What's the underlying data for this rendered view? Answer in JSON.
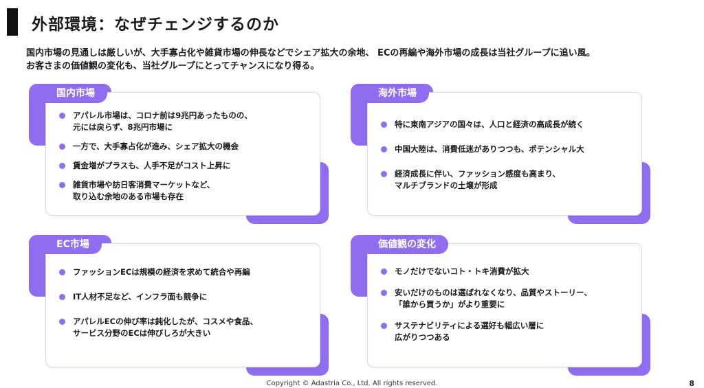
{
  "page": {
    "title": "外部環境：なぜチェンジするのか",
    "intro_lines": [
      "国内市場の見通しは厳しいが、大手寡占化や雑貨市場の伸長などでシェア拡大の余地、 ECの再編や海外市場の成長は当社グループに追い風。",
      "お客さまの価値観の変化も、当社グループにとってチャンスになり得る。"
    ],
    "accent_color": "#8f6df0"
  },
  "panels": {
    "domestic": {
      "tag": "国内市場",
      "items": [
        [
          "アパレル市場は、コロナ前は9兆円あったものの、",
          "元には戻らず、8兆円市場に"
        ],
        [
          "一方で、大手寡占化が進み、シェア拡大の機会"
        ],
        [
          "賃金増がプラスも、人手不足がコスト上昇に"
        ],
        [
          "雑貨市場や訪日客消費マーケットなど、",
          "取り込む余地のある市場も存在"
        ]
      ]
    },
    "overseas": {
      "tag": "海外市場",
      "items": [
        [
          "特に東南アジアの国々は、人口と経済の高成長が続く"
        ],
        [
          "中国大陸は、消費低迷がありつつも、ポテンシャル大"
        ],
        [
          "経済成長に伴い、ファッション感度も高まり、",
          "マルチブランドの土壌が形成"
        ]
      ]
    },
    "ec": {
      "tag": "EC市場",
      "items": [
        [
          "ファッションECは規模の経済を求めて統合や再編"
        ],
        [
          "IT人材不足など、インフラ面も競争に"
        ],
        [
          "アパレルECの伸び率は鈍化したが、コスメや食品、",
          "サービス分野のECは伸びしろが大きい"
        ]
      ]
    },
    "values": {
      "tag": "価値観の変化",
      "items": [
        [
          "モノだけでないコト・トキ消費が拡大"
        ],
        [
          "安いだけのものは選ばれなくなり、品質やストーリー、",
          "「誰から買うか」がより重要に"
        ],
        [
          "サステナビリティによる選好も幅広い層に",
          "広がりつつある"
        ]
      ]
    }
  },
  "footer": {
    "copyright": "Copyright © Adastria Co., Ltd. All rights reserved.",
    "page_number": "8"
  }
}
